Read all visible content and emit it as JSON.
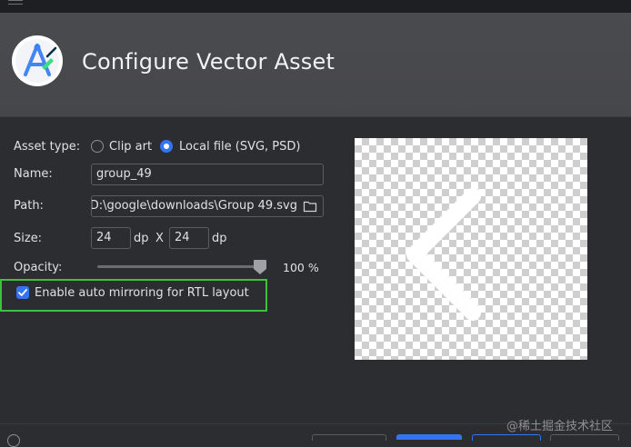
{
  "window": {
    "title": "Configure Vector Asset"
  },
  "form": {
    "asset_type_label": "Asset type:",
    "clip_art_label": "Clip art",
    "local_file_label": "Local file (SVG, PSD)",
    "selected_asset_type": "Local file (SVG, PSD)",
    "name_label": "Name:",
    "name_value": "group_49",
    "path_label": "Path:",
    "path_value": "D:\\google\\downloads\\Group 49.svg",
    "size_label": "Size:",
    "width_value": "24",
    "height_value": "24",
    "unit_dp": "dp",
    "size_separator": "X",
    "opacity_label": "Opacity:",
    "opacity_percent": 100,
    "opacity_display": "100 %",
    "auto_mirror_label": "Enable auto mirroring for RTL layout",
    "auto_mirror_checked": true
  },
  "preview": {
    "icon": "chevron-left-icon",
    "icon_color": "#ffffff"
  },
  "watermark": "@稀土掘金技术社区",
  "colors": {
    "accent": "#3574f0",
    "highlight": "#3ec23e",
    "header_bg": "#4a4b4e",
    "body_bg": "#2b2d30"
  }
}
